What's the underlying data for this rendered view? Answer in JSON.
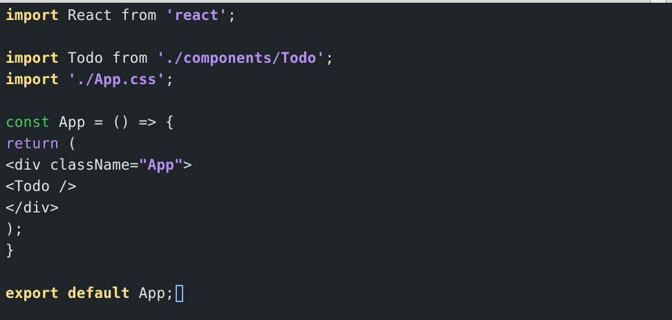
{
  "code": {
    "line1": {
      "kw": "import",
      "text1": " React from ",
      "string": "'react'",
      "text2": ";"
    },
    "line3": {
      "kw": "import",
      "text1": " Todo from ",
      "string": "'./components/Todo'",
      "text2": ";"
    },
    "line4": {
      "kw": "import",
      "text1": " ",
      "string": "'./App.css'",
      "text2": ";"
    },
    "line6": {
      "kw": "const",
      "text1": " App = () => {"
    },
    "line7": {
      "kw": "return",
      "text1": " ("
    },
    "line8": {
      "text1": "<div className=",
      "string": "\"App\"",
      "text2": ">"
    },
    "line9": {
      "text1": "<Todo />"
    },
    "line10": {
      "text1": "</div>"
    },
    "line11": {
      "text1": ");"
    },
    "line12": {
      "text1": "}"
    },
    "line14": {
      "kw1": "export",
      "kw2": "default",
      "text1": " App;"
    }
  },
  "colors": {
    "background": "#1f2428",
    "keyword_import": "#ffe082",
    "keyword_const": "#3fcf5b",
    "keyword_return": "#b392f0",
    "string": "#b392f0",
    "text": "#e1e4e8",
    "cursor": "#79b8ff"
  }
}
